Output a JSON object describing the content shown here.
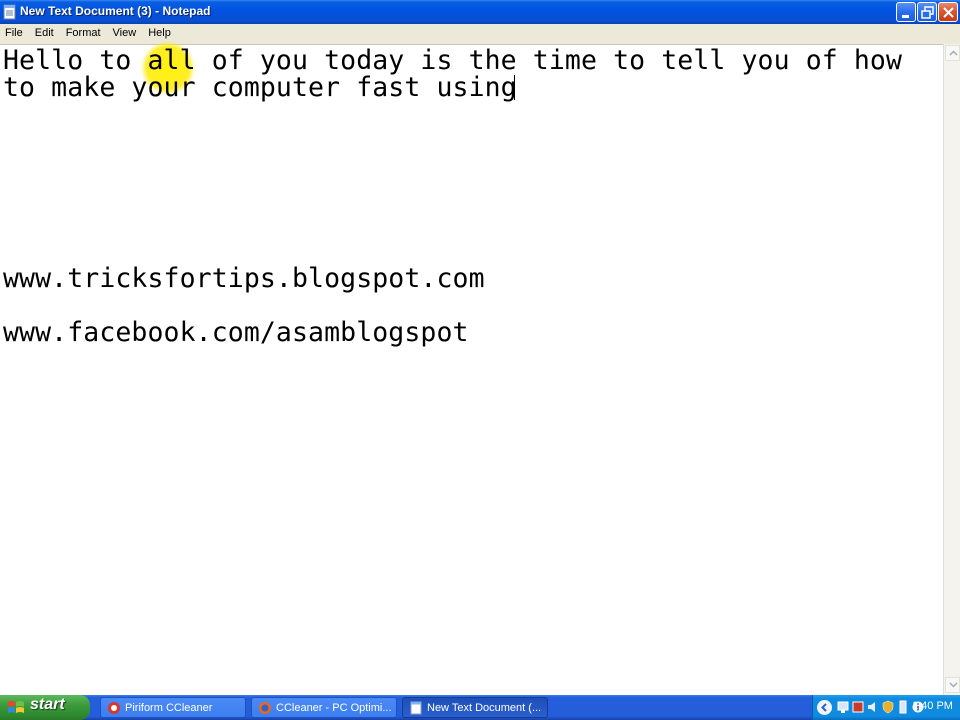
{
  "window": {
    "title": "New Text Document (3) - Notepad"
  },
  "menu": {
    "items": [
      "File",
      "Edit",
      "Format",
      "View",
      "Help"
    ]
  },
  "editor": {
    "lines": [
      "Hello to all of you today is the time to tell you of how",
      "to make your computer fast using",
      "www.tricksfortips.blogspot.com",
      "www.facebook.com/asamblogspot"
    ]
  },
  "taskbar": {
    "start_label": "start",
    "tasks": [
      {
        "label": "Piriform CCleaner",
        "icon": "ccleaner-icon"
      },
      {
        "label": "CCleaner - PC Optimi...",
        "icon": "firefox-icon"
      },
      {
        "label": "New Text Document (...",
        "icon": "notepad-icon"
      }
    ],
    "clock": "1:40 PM"
  },
  "colors": {
    "titlebar_blue": "#0054e3",
    "menu_bg": "#ece9d8",
    "taskbar_blue": "#245edb",
    "start_green": "#3c9a3c",
    "highlight_yellow": "#fff000"
  }
}
